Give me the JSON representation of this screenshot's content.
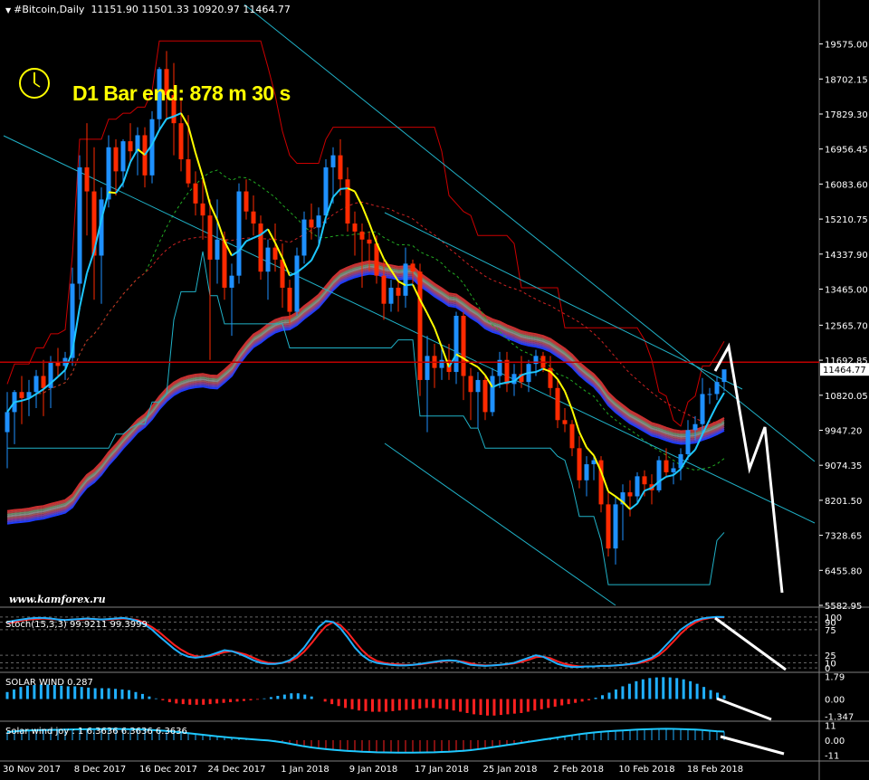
{
  "header": {
    "symbol": "#Bitcoin,Daily",
    "ohlc": "11151.90 11501.33 10920.97 11464.77"
  },
  "overlay": {
    "bar_end_text": "D1 Bar end: 878 m 30 s",
    "watermark": "www.kamforex.ru",
    "current_price": "11464.77"
  },
  "colors": {
    "background": "#000000",
    "bull": "#1e90ff",
    "bear": "#ff2a00",
    "ma_fast": "#ffff00",
    "ma_fast_alt": "#1ec8ff",
    "channel": "#20b2c8",
    "envelope": "#cc0000",
    "bar_end_text": "#ffff00"
  },
  "chart_data": [
    {
      "type": "candlestick",
      "title": "#Bitcoin,Daily",
      "ylim": [
        5582.95,
        20400
      ],
      "y_ticks": [
        19575.0,
        18702.15,
        17829.3,
        16956.45,
        16083.6,
        15210.75,
        14337.9,
        13465.0,
        12565.7,
        11692.85,
        10820.05,
        9947.2,
        9074.35,
        8201.5,
        7328.65,
        6455.8,
        5582.95
      ],
      "x_tick_labels": [
        "30 Nov 2017",
        "8 Dec 2017",
        "16 Dec 2017",
        "24 Dec 2017",
        "1 Jan 2018",
        "9 Jan 2018",
        "17 Jan 2018",
        "25 Jan 2018",
        "2 Feb 2018",
        "10 Feb 2018",
        "18 Feb 2018"
      ],
      "candles": [
        [
          9900,
          10900,
          9000,
          10400
        ],
        [
          10400,
          10950,
          9600,
          10900
        ],
        [
          10900,
          11300,
          10100,
          10750
        ],
        [
          10750,
          11200,
          10300,
          10900
        ],
        [
          10900,
          11450,
          10500,
          11300
        ],
        [
          11300,
          11700,
          10300,
          11000
        ],
        [
          11000,
          11800,
          10500,
          11650
        ],
        [
          11650,
          12000,
          11300,
          11550
        ],
        [
          11550,
          11900,
          11200,
          11750
        ],
        [
          11750,
          14000,
          11550,
          13600
        ],
        [
          13600,
          16800,
          13200,
          16500
        ],
        [
          16500,
          17600,
          14800,
          15900
        ],
        [
          15900,
          17000,
          13200,
          14300
        ],
        [
          14300,
          16000,
          13100,
          15700
        ],
        [
          15700,
          17300,
          15500,
          17000
        ],
        [
          17000,
          17200,
          15800,
          16400
        ],
        [
          16400,
          17200,
          16000,
          17150
        ],
        [
          17150,
          17600,
          16600,
          16900
        ],
        [
          16900,
          17500,
          16300,
          17300
        ],
        [
          17300,
          17500,
          16000,
          16300
        ],
        [
          16300,
          17900,
          16100,
          17700
        ],
        [
          17700,
          19000,
          17400,
          18950
        ],
        [
          18950,
          19400,
          17700,
          18300
        ],
        [
          18300,
          19100,
          16800,
          17600
        ],
        [
          17600,
          18200,
          16400,
          16700
        ],
        [
          16700,
          17800,
          16000,
          16100
        ],
        [
          16100,
          16400,
          15300,
          15600
        ],
        [
          15600,
          16200,
          14700,
          15300
        ],
        [
          15300,
          15700,
          11700,
          14200
        ],
        [
          14200,
          15700,
          13600,
          14700
        ],
        [
          14700,
          14900,
          13200,
          13500
        ],
        [
          13500,
          14100,
          12300,
          13800
        ],
        [
          13800,
          16100,
          13600,
          15900
        ],
        [
          15900,
          16200,
          15200,
          15400
        ],
        [
          15400,
          15800,
          14800,
          15100
        ],
        [
          15100,
          15300,
          13700,
          13900
        ],
        [
          13900,
          14700,
          13200,
          14500
        ],
        [
          14500,
          15100,
          13900,
          14200
        ],
        [
          14200,
          14600,
          13000,
          13500
        ],
        [
          13500,
          13700,
          12600,
          12900
        ],
        [
          12900,
          14500,
          12800,
          14300
        ],
        [
          14300,
          15400,
          14100,
          15200
        ],
        [
          15200,
          15600,
          14700,
          15000
        ],
        [
          15000,
          15500,
          14600,
          15300
        ],
        [
          15300,
          16700,
          15100,
          16500
        ],
        [
          16500,
          17000,
          15600,
          16800
        ],
        [
          16800,
          17200,
          15800,
          16200
        ],
        [
          16200,
          16500,
          14900,
          15100
        ],
        [
          15100,
          15400,
          14300,
          14900
        ],
        [
          14900,
          15100,
          13500,
          14700
        ],
        [
          14700,
          14900,
          13900,
          14600
        ],
        [
          14600,
          14800,
          13600,
          13800
        ],
        [
          13800,
          14200,
          12700,
          13100
        ],
        [
          13100,
          13700,
          12900,
          13500
        ],
        [
          13500,
          13700,
          12900,
          13300
        ],
        [
          13300,
          14500,
          13000,
          14100
        ],
        [
          14100,
          14200,
          13600,
          13900
        ],
        [
          13900,
          14100,
          10800,
          11200
        ],
        [
          11200,
          12300,
          9900,
          11800
        ],
        [
          11800,
          12100,
          11000,
          11500
        ],
        [
          11500,
          12000,
          11200,
          11700
        ],
        [
          11700,
          12100,
          11200,
          11400
        ],
        [
          11400,
          12900,
          11100,
          12800
        ],
        [
          12800,
          12900,
          10700,
          11300
        ],
        [
          11300,
          11500,
          10200,
          10900
        ],
        [
          10900,
          11400,
          10000,
          11200
        ],
        [
          11200,
          11300,
          10200,
          10400
        ],
        [
          10400,
          11500,
          10300,
          11300
        ],
        [
          11300,
          11900,
          11000,
          11700
        ],
        [
          11700,
          11900,
          10900,
          11100
        ],
        [
          11100,
          11600,
          10800,
          11350
        ],
        [
          11350,
          11800,
          11000,
          11150
        ],
        [
          11150,
          11700,
          10900,
          11600
        ],
        [
          11600,
          11950,
          11300,
          11800
        ],
        [
          11800,
          11900,
          11400,
          11500
        ],
        [
          11500,
          11800,
          10800,
          11000
        ],
        [
          11000,
          11200,
          10000,
          10200
        ],
        [
          10200,
          10500,
          9900,
          10100
        ],
        [
          10100,
          10200,
          9300,
          9500
        ],
        [
          9500,
          9800,
          8500,
          8700
        ],
        [
          8700,
          9300,
          8300,
          9100
        ],
        [
          9100,
          9300,
          8700,
          9200
        ],
        [
          9200,
          9300,
          7900,
          8100
        ],
        [
          8100,
          8400,
          6800,
          7000
        ],
        [
          7000,
          8300,
          6600,
          8100
        ],
        [
          8100,
          8600,
          7200,
          8400
        ],
        [
          8400,
          8700,
          7800,
          8300
        ],
        [
          8300,
          8900,
          8100,
          8800
        ],
        [
          8800,
          8950,
          8300,
          8600
        ],
        [
          8600,
          8850,
          8100,
          8450
        ],
        [
          8450,
          9300,
          8400,
          9200
        ],
        [
          9200,
          9500,
          8800,
          8900
        ],
        [
          8900,
          9150,
          8600,
          9000
        ],
        [
          9000,
          9500,
          8700,
          9350
        ],
        [
          9350,
          10200,
          9200,
          9950
        ],
        [
          9950,
          10300,
          9700,
          10100
        ],
        [
          10100,
          11250,
          9800,
          10850
        ],
        [
          10850,
          11000,
          10600,
          10850
        ],
        [
          10850,
          11300,
          10700,
          11150
        ],
        [
          11150,
          11450,
          10920,
          11464.77
        ]
      ]
    },
    {
      "type": "line",
      "title": "Stoch(15,3,3) 99.9211 99.3999",
      "ylim": [
        -5,
        105
      ],
      "y_ticks": [
        100,
        90,
        75,
        25,
        10,
        0
      ],
      "series": [
        {
          "values": [
            90,
            93,
            95,
            97,
            98,
            98,
            97,
            95,
            94,
            95,
            96,
            97,
            96,
            95,
            96,
            97,
            98,
            96,
            92,
            85,
            75,
            62,
            50,
            38,
            28,
            22,
            20,
            22,
            25,
            30,
            35,
            33,
            28,
            22,
            15,
            10,
            8,
            8,
            10,
            15,
            25,
            40,
            60,
            80,
            92,
            90,
            78,
            60,
            40,
            25,
            15,
            10,
            8,
            6,
            5,
            5,
            6,
            8,
            10,
            12,
            14,
            15,
            14,
            10,
            6,
            5,
            4,
            5,
            6,
            8,
            10,
            15,
            20,
            25,
            22,
            15,
            8,
            4,
            2,
            2,
            3,
            3,
            4,
            4,
            5,
            6,
            8,
            10,
            15,
            20,
            30,
            45,
            60,
            75,
            85,
            93,
            97,
            99,
            100,
            99.9211
          ]
        },
        {
          "values": [
            88,
            90,
            93,
            95,
            96,
            97,
            96,
            95,
            94,
            95,
            95,
            96,
            96,
            95,
            95,
            96,
            97,
            96,
            94,
            88,
            80,
            70,
            58,
            46,
            36,
            28,
            23,
            22,
            23,
            27,
            31,
            33,
            30,
            26,
            20,
            14,
            10,
            9,
            10,
            13,
            20,
            32,
            48,
            66,
            82,
            90,
            84,
            70,
            52,
            35,
            22,
            14,
            10,
            8,
            7,
            6,
            6,
            7,
            9,
            11,
            13,
            14,
            14,
            12,
            9,
            6,
            5,
            5,
            6,
            7,
            9,
            12,
            16,
            21,
            22,
            19,
            13,
            8,
            5,
            3,
            3,
            3,
            4,
            4,
            5,
            6,
            7,
            9,
            12,
            17,
            25,
            37,
            52,
            67,
            80,
            89,
            95,
            98,
            99.5,
            99.3999
          ]
        }
      ]
    },
    {
      "type": "bar",
      "title": "SOLAR WIND 0.287",
      "ylim": [
        -1.6,
        2.1
      ],
      "y_ticks": [
        1.79,
        0.0,
        -1.347
      ],
      "values": [
        0.55,
        0.75,
        0.95,
        1.05,
        1.1,
        1.15,
        1.15,
        1.1,
        1.05,
        1.0,
        1.0,
        0.95,
        0.9,
        0.85,
        0.85,
        0.85,
        0.8,
        0.75,
        0.7,
        0.55,
        0.4,
        0.2,
        0.05,
        -0.1,
        -0.25,
        -0.35,
        -0.4,
        -0.45,
        -0.45,
        -0.45,
        -0.4,
        -0.35,
        -0.3,
        -0.25,
        -0.2,
        -0.15,
        -0.1,
        -0.05,
        0.05,
        0.15,
        0.25,
        0.35,
        0.45,
        0.45,
        0.35,
        0.2,
        0.0,
        -0.2,
        -0.4,
        -0.55,
        -0.7,
        -0.8,
        -0.9,
        -0.95,
        -1.0,
        -1.0,
        -1.0,
        -0.95,
        -0.9,
        -0.85,
        -0.8,
        -0.75,
        -0.7,
        -0.7,
        -0.75,
        -0.8,
        -0.9,
        -1.0,
        -1.1,
        -1.2,
        -1.25,
        -1.3,
        -1.3,
        -1.25,
        -1.2,
        -1.15,
        -1.1,
        -1.0,
        -0.9,
        -0.8,
        -0.7,
        -0.6,
        -0.5,
        -0.4,
        -0.3,
        -0.2,
        -0.1,
        0.1,
        0.3,
        0.5,
        0.75,
        1.0,
        1.2,
        1.4,
        1.55,
        1.65,
        1.7,
        1.72,
        1.7,
        1.65,
        1.55,
        1.4,
        1.2,
        0.95,
        0.7,
        0.5,
        0.287
      ]
    },
    {
      "type": "line",
      "title": "Solar wind joy : 1 6.3636 6.3636 6.3636",
      "ylim": [
        -14,
        14
      ],
      "y_ticks": [
        11,
        0.0,
        -11
      ],
      "values": [
        6,
        6.5,
        7,
        7.2,
        7.4,
        7.5,
        7.6,
        7.7,
        7.8,
        7.9,
        8,
        8.1,
        8.2,
        8.2,
        8.3,
        8.3,
        8.2,
        8.1,
        8,
        7.8,
        7.5,
        7.2,
        6.8,
        6.3,
        5.8,
        5.2,
        4.6,
        4,
        3.4,
        2.8,
        2.3,
        1.8,
        1.4,
        1.0,
        0.6,
        0.2,
        -0.2,
        -0.8,
        -1.6,
        -2.6,
        -3.6,
        -4.5,
        -5.3,
        -6,
        -6.6,
        -7.1,
        -7.5,
        -7.9,
        -8.2,
        -8.5,
        -8.7,
        -8.9,
        -9.0,
        -9.1,
        -9.2,
        -9.2,
        -9.2,
        -9.1,
        -9.0,
        -8.9,
        -8.7,
        -8.5,
        -8.2,
        -7.8,
        -7.3,
        -6.7,
        -6.0,
        -5.2,
        -4.4,
        -3.6,
        -2.8,
        -2.0,
        -1.2,
        -0.4,
        0.4,
        1.2,
        2.0,
        2.8,
        3.6,
        4.4,
        5.1,
        5.7,
        6.2,
        6.6,
        6.9,
        7.2,
        7.5,
        7.8,
        8.0,
        8.2,
        8.3,
        8.4,
        8.3,
        8.2,
        8.0,
        7.8,
        7.5,
        7.0,
        6.6,
        6.3636
      ]
    }
  ]
}
